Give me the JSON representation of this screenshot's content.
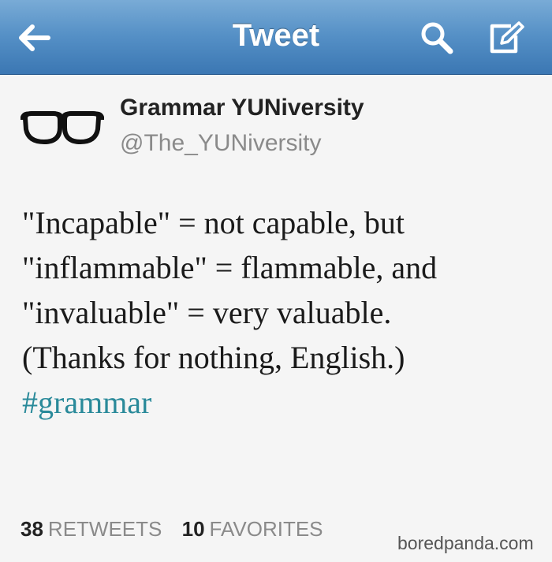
{
  "navbar": {
    "title": "Tweet",
    "back_icon": "arrow-left-icon",
    "search_icon": "search-icon",
    "compose_icon": "compose-icon",
    "color": "#5590c6"
  },
  "tweet": {
    "author": {
      "display_name": "Grammar YUNiversity",
      "handle": "@The_YUNiversity",
      "avatar_icon": "glasses-icon"
    },
    "text_lines": [
      "\"Incapable\" = not capable, but",
      "\"inflammable\" = flammable, and",
      "\"invaluable\" = very valuable.",
      "(Thanks for nothing, English.)"
    ],
    "hashtag": "#grammar",
    "hashtag_color": "#2a8a9a"
  },
  "stats": {
    "retweets_count": "38",
    "retweets_label": "RETWEETS",
    "favorites_count": "10",
    "favorites_label": "FAVORITES"
  },
  "watermark": "boredpanda.com"
}
